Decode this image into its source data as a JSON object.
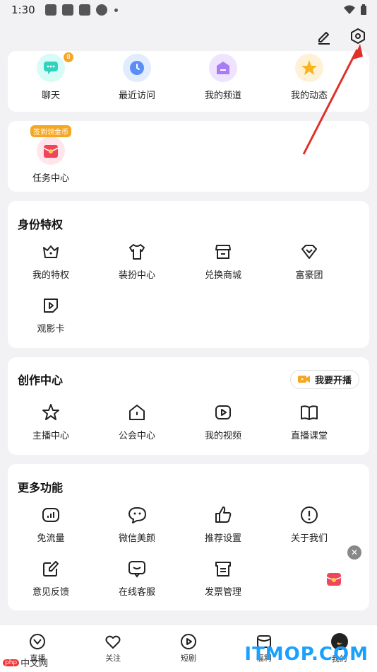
{
  "status_bar": {
    "time": "1:30"
  },
  "quick_row": [
    {
      "label": "聊天",
      "icon": "chat-icon",
      "badge": "8"
    },
    {
      "label": "最近访问",
      "icon": "clock-icon"
    },
    {
      "label": "我的频道",
      "icon": "channel-icon"
    },
    {
      "label": "我的动态",
      "icon": "star-icon"
    }
  ],
  "task_card": {
    "label": "任务中心",
    "tag": "签到领金币"
  },
  "privilege": {
    "title": "身份特权",
    "items": [
      {
        "label": "我的特权"
      },
      {
        "label": "装扮中心"
      },
      {
        "label": "兑换商城"
      },
      {
        "label": "富豪团"
      },
      {
        "label": "观影卡"
      }
    ]
  },
  "creation": {
    "title": "创作中心",
    "live_button": "我要开播",
    "items": [
      {
        "label": "主播中心"
      },
      {
        "label": "公会中心"
      },
      {
        "label": "我的视频"
      },
      {
        "label": "直播课堂"
      }
    ]
  },
  "more": {
    "title": "更多功能",
    "items": [
      {
        "label": "免流量"
      },
      {
        "label": "微信美颜"
      },
      {
        "label": "推荐设置"
      },
      {
        "label": "关于我们"
      },
      {
        "label": "意见反馈"
      },
      {
        "label": "在线客服"
      },
      {
        "label": "发票管理"
      }
    ]
  },
  "bottom_nav": [
    {
      "label": "直播"
    },
    {
      "label": "关注"
    },
    {
      "label": "短剧"
    },
    {
      "label": "福利"
    },
    {
      "label": "我的"
    }
  ],
  "watermark": {
    "right": "ITMOP.COM",
    "left_badge": "php",
    "left_text": "中文网"
  },
  "colors": {
    "accent": "#f5a623",
    "arrow": "#e0302a"
  }
}
